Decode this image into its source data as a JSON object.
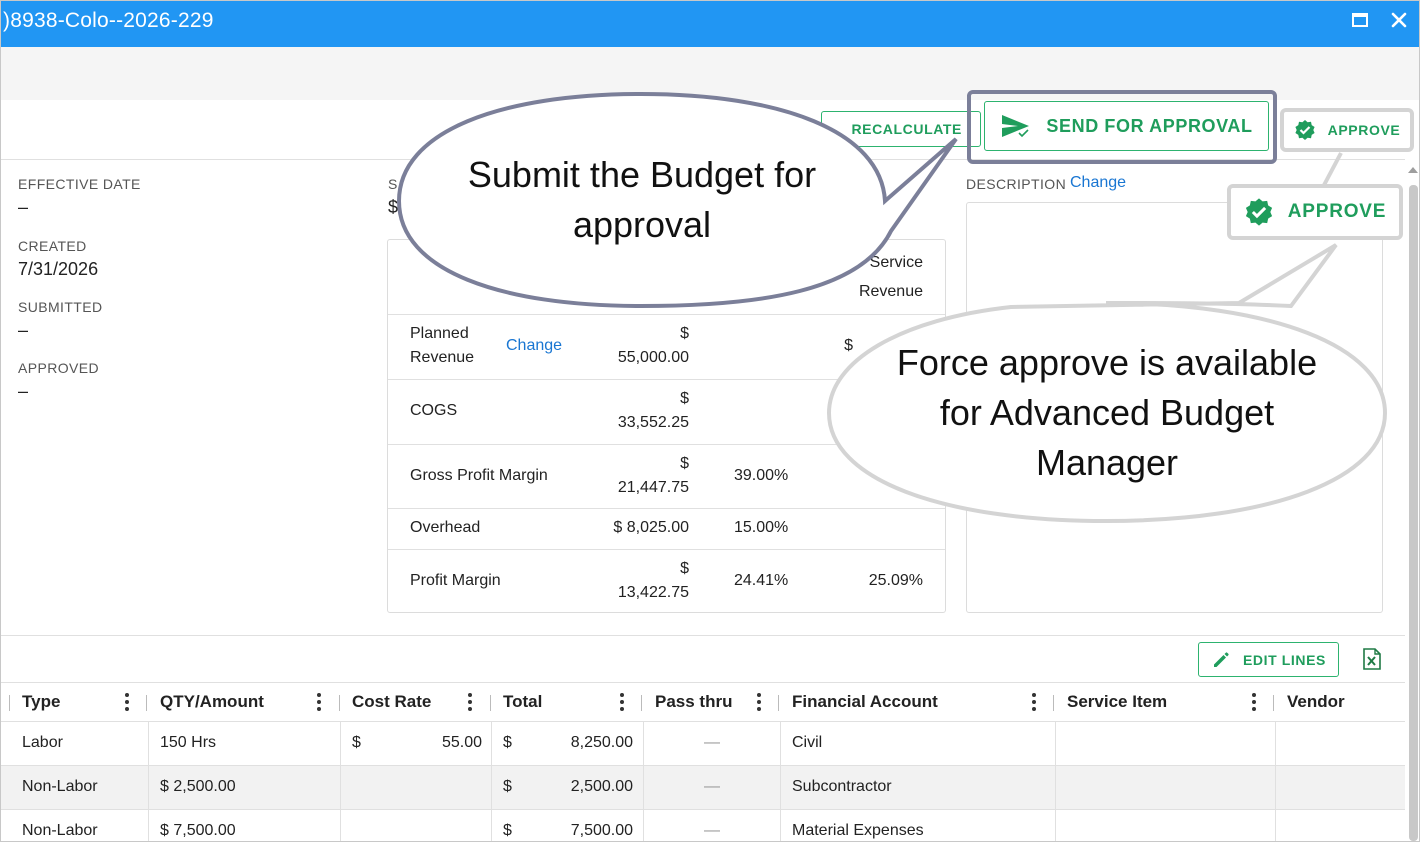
{
  "window": {
    "title": ")8938-Colo--2026-229"
  },
  "toolbar": {
    "recalculate_label": "RECALCULATE",
    "send_for_approval_label": "SEND FOR APPROVAL",
    "approve_label": "APPROVE"
  },
  "fields": {
    "effective_date": {
      "label": "EFFECTIVE DATE",
      "value": "–"
    },
    "created": {
      "label": "CREATED",
      "value": "7/31/2026"
    },
    "submitted": {
      "label": "SUBMITTED",
      "value": "–"
    },
    "approved": {
      "label": "APPROVED",
      "value": "–"
    },
    "partial_label": "S",
    "partial_value": "$"
  },
  "description": {
    "label": "DESCRIPTION",
    "change_label": "Change"
  },
  "summary": {
    "col_header_line1": "Service",
    "col_header_line2": "Revenue",
    "rows": [
      {
        "name_line1": "Planned",
        "name_line2": "Revenue",
        "change": "Change",
        "currency": "$",
        "amount": "55,000.00",
        "pct": "",
        "pct2": "$ "
      },
      {
        "name": "COGS",
        "currency": "$",
        "amount": "33,552.25",
        "pct": "",
        "pct2": ""
      },
      {
        "name": "Gross Profit Margin",
        "currency": "$",
        "amount": "21,447.75",
        "pct": "39.00%",
        "pct2": ""
      },
      {
        "name": "Overhead",
        "amount": "$ 8,025.00",
        "pct": "15.00%",
        "pct2": ""
      },
      {
        "name": "Profit Margin",
        "currency": "$",
        "amount": "13,422.75",
        "pct": "24.41%",
        "pct2": "25.09%"
      }
    ]
  },
  "lines": {
    "edit_lines_label": "EDIT LINES",
    "columns": [
      "Type",
      "QTY/Amount",
      "Cost Rate",
      "Total",
      "Pass thru",
      "Financial Account",
      "Service Item",
      "Vendor"
    ],
    "rows": [
      {
        "type": "Labor",
        "qty": "150 Hrs",
        "cost_currency": "$",
        "cost_rate": "55.00",
        "total_currency": "$",
        "total": "8,250.00",
        "pass_thru": "—",
        "account": "Civil"
      },
      {
        "type": "Non-Labor",
        "qty": "$ 2,500.00",
        "cost_currency": "",
        "cost_rate": "",
        "total_currency": "$",
        "total": "2,500.00",
        "pass_thru": "—",
        "account": "Subcontractor"
      },
      {
        "type": "Non-Labor",
        "qty": "$ 7,500.00",
        "cost_currency": "",
        "cost_rate": "",
        "total_currency": "$",
        "total": "7,500.00",
        "pass_thru": "—",
        "account": "Material Expenses"
      }
    ]
  },
  "callouts": {
    "submit_line1": "Submit the Budget for",
    "submit_line2": "approval",
    "force_line1": "Force approve is available",
    "force_line2": "for Advanced Budget",
    "force_line3": "Manager"
  },
  "colors": {
    "titlebar": "#2196f3",
    "accent_green": "#1f9d5c",
    "link_blue": "#1976d2",
    "callout_border": "#7b7f99"
  }
}
